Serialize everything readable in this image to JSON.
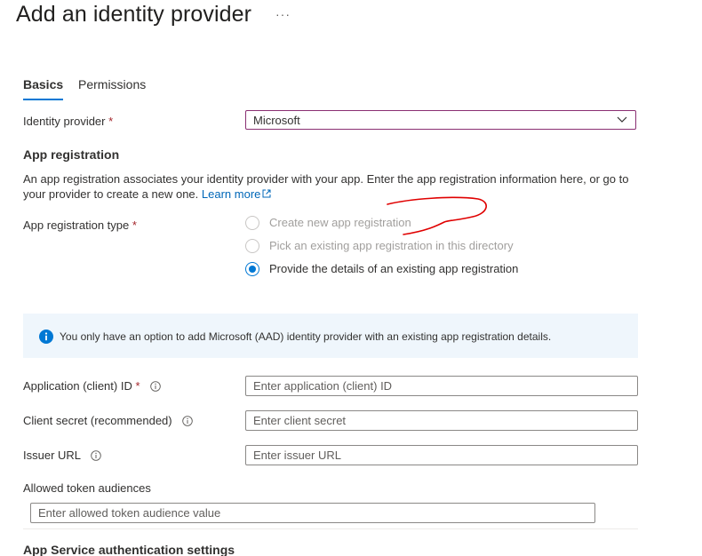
{
  "header": {
    "title": "Add an identity provider",
    "more_label": "···"
  },
  "tabs": [
    {
      "label": "Basics",
      "selected": true
    },
    {
      "label": "Permissions",
      "selected": false
    }
  ],
  "identity_provider": {
    "label": "Identity provider",
    "required_mark": "*",
    "value": "Microsoft"
  },
  "app_registration": {
    "heading": "App registration",
    "description": "An app registration associates your identity provider with your app. Enter the app registration information here, or go to your provider to create a new one.",
    "learn_more": "Learn more",
    "type_label": "App registration type",
    "required_mark": "*",
    "options": [
      {
        "label": "Create new app registration",
        "selected": false,
        "disabled": true
      },
      {
        "label": "Pick an existing app registration in this directory",
        "selected": false,
        "disabled": true
      },
      {
        "label": "Provide the details of an existing app registration",
        "selected": true,
        "disabled": false
      }
    ]
  },
  "info_banner": {
    "text": "You only have an option to add Microsoft (AAD) identity provider with an existing app registration details."
  },
  "fields": {
    "client_id": {
      "label": "Application (client) ID",
      "required_mark": "*",
      "placeholder": "Enter application (client) ID"
    },
    "client_secret": {
      "label": "Client secret (recommended)",
      "placeholder": "Enter client secret"
    },
    "issuer_url": {
      "label": "Issuer URL",
      "placeholder": "Enter issuer URL"
    },
    "allowed_audiences": {
      "label": "Allowed token audiences",
      "placeholder": "Enter allowed token audience value"
    }
  },
  "auth_settings": {
    "heading": "App Service authentication settings"
  },
  "colors": {
    "accent": "#0078d4",
    "required": "#a4262c",
    "info_background": "#eff6fc",
    "annotation": "#e00000"
  }
}
